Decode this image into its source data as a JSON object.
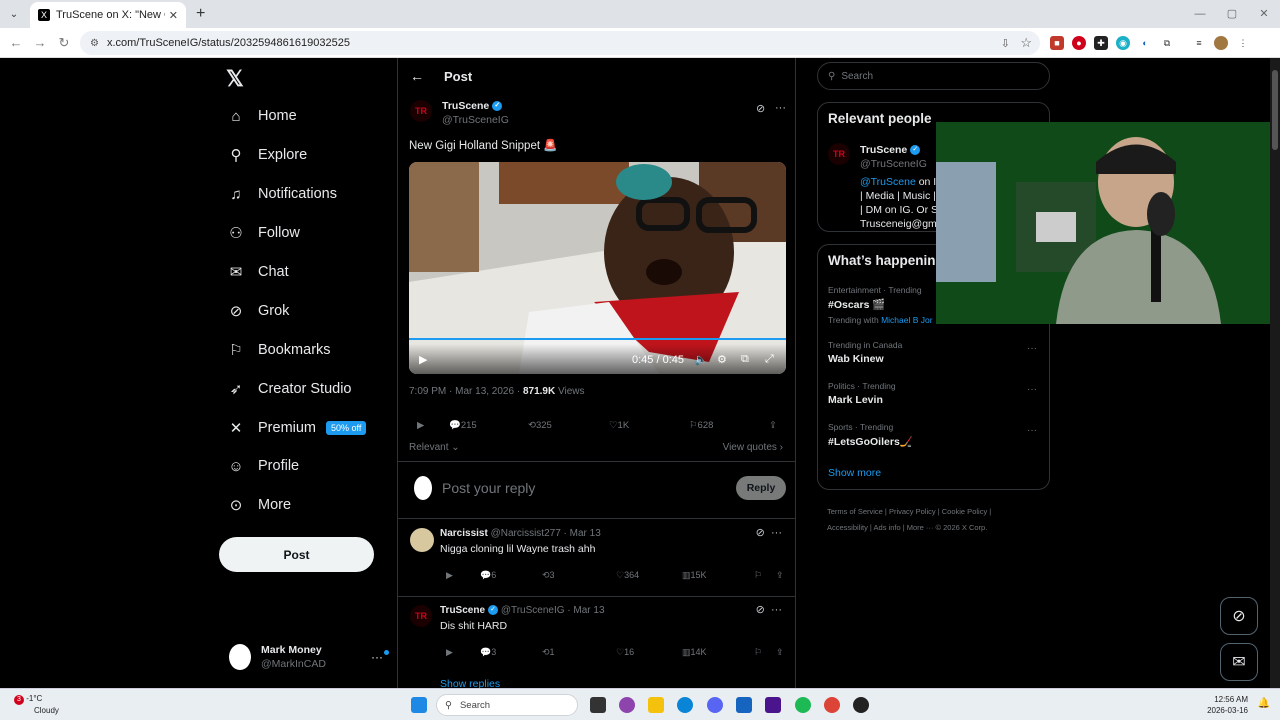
{
  "browser": {
    "tab_title": "TruScene on X: \"New Gigi Holla",
    "url": "x.com/TruSceneIG/status/2032594861619032525"
  },
  "nav": {
    "items": [
      {
        "label": "Home",
        "icon": "home-icon"
      },
      {
        "label": "Explore",
        "icon": "search-icon"
      },
      {
        "label": "Notifications",
        "icon": "bell-icon"
      },
      {
        "label": "Follow",
        "icon": "add-person-icon"
      },
      {
        "label": "Chat",
        "icon": "mail-icon"
      },
      {
        "label": "Grok",
        "icon": "grok-icon"
      },
      {
        "label": "Bookmarks",
        "icon": "bookmark-icon"
      },
      {
        "label": "Creator Studio",
        "icon": "rocket-icon"
      },
      {
        "label": "Premium",
        "icon": "x-icon",
        "badge": "50% off"
      },
      {
        "label": "Profile",
        "icon": "person-icon"
      },
      {
        "label": "More",
        "icon": "more-circle-icon"
      }
    ],
    "post_button": "Post",
    "account": {
      "name": "Mark Money",
      "handle": "@MarkInCAD"
    }
  },
  "post": {
    "header": "Post",
    "author": {
      "name": "TruScene",
      "handle": "@TruSceneIG"
    },
    "text": "New Gigi Holland Snippet 🚨",
    "video": {
      "time": "0:45 / 0:45"
    },
    "timestamp": "7:09 PM · Mar 13, 2026 · ",
    "views_count": "871.9K",
    "views_label": " Views",
    "stats": {
      "replies": "215",
      "reposts": "325",
      "likes": "1K",
      "bookmarks": "628"
    },
    "sort": "Relevant",
    "view_quotes": "View quotes",
    "reply_placeholder": "Post your reply",
    "reply_button": "Reply"
  },
  "replies": [
    {
      "name": "Narcissist",
      "meta": "@Narcissist277 · Mar 13",
      "text": "Nigga cloning lil Wayne trash ahh",
      "replies": "6",
      "reposts": "3",
      "likes": "364",
      "views": "15K"
    },
    {
      "name": "TruScene",
      "meta": "@TruSceneIG · Mar 13",
      "text": "Dis shit HARD",
      "replies": "3",
      "reposts": "1",
      "likes": "16",
      "views": "14K"
    }
  ],
  "show_replies": "Show replies",
  "sidebar": {
    "search_placeholder": "Search",
    "relevant_title": "Relevant people",
    "person": {
      "name": "TruScene",
      "handle": "@TruSceneIG",
      "bio1": "@TruScene",
      "bio1b": " on IG",
      "bio2": "| Media | Music | C",
      "bio3": "| DM on IG. Or Sh",
      "bio4": "Trusceneig@gma"
    },
    "happening_title": "What’s happening",
    "trends": [
      {
        "context": "Entertainment · Trending",
        "name": "#Oscars 🎬",
        "extra_label": "Trending with ",
        "extra_value": "Michael B Jor"
      },
      {
        "context": "Trending in Canada",
        "name": "Wab Kinew"
      },
      {
        "context": "Politics · Trending",
        "name": "Mark Levin"
      },
      {
        "context": "Sports · Trending",
        "name": "#LetsGoOilers🏒"
      }
    ],
    "show_more": "Show more",
    "footer": {
      "l1": "Terms of Service  |  Privacy Policy  |  Cookie Policy  |",
      "l2": "Accessibility  |  Ads info  |  More ···  © 2026 X Corp."
    }
  },
  "taskbar": {
    "weather_temp": "-1°C",
    "weather_desc": "Cloudy",
    "weather_badge": "3",
    "search": "Search",
    "time": "12:56 AM",
    "date": "2026-03-16"
  }
}
